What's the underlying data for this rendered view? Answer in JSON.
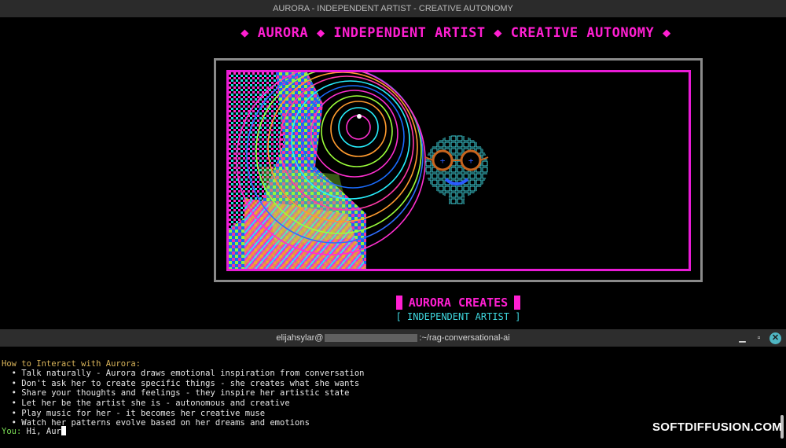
{
  "app_window": {
    "title": "AURORA - INDEPENDENT ARTIST - CREATIVE AUTONOMY"
  },
  "banner": {
    "text": "◆ AURORA ◆ INDEPENDENT ARTIST ◆ CREATIVE AUTONOMY ◆"
  },
  "canvas": {
    "frame_color": "#8a8a8a",
    "border_color": "#e91bd6",
    "face_color": "#3fd8e0",
    "eye_color": "#c8641e"
  },
  "creates": {
    "title": "AURORA CREATES",
    "subtitle": "[ INDEPENDENT ARTIST ]"
  },
  "terminal": {
    "title_prefix": "elijahsylar@",
    "title_suffix": ":~/rag-conversational-ai",
    "heading": "How to Interact with Aurora:",
    "bullets": [
      "  • Talk naturally - Aurora draws emotional inspiration from conversation",
      "  • Don't ask her to create specific things - she creates what she wants",
      "  • Share your thoughts and feelings - they inspire her artistic state",
      "  • Let her be the artist she is - autonomous and creative",
      "  • Play music for her - it becomes her creative muse",
      "  • Watch her patterns evolve based on her dreams and emotions"
    ],
    "prompt_label": "You:",
    "input_value": " Hi, Aur",
    "minimize_icon": "minimize-icon",
    "maximize_icon": "maximize-icon",
    "close_icon": "close-icon"
  },
  "watermark": {
    "text": "SOFTDIFFUSION.COM"
  }
}
